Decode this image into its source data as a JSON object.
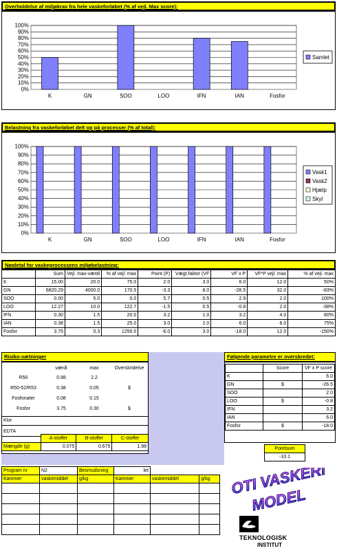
{
  "chart1": {
    "title": "Overholdelse af miljøkrav fra hele vaskeforløbet (% af vejl. Max score):",
    "chart_data": {
      "type": "bar",
      "categories": [
        "K",
        "GN",
        "SOO",
        "LOO",
        "IFN",
        "IAN",
        "Fosfor"
      ],
      "series": [
        {
          "name": "Samlet",
          "values": [
            50,
            0,
            100,
            0,
            80,
            75,
            0
          ]
        }
      ],
      "ylim": [
        0,
        100
      ],
      "yticks": [
        "0%",
        "10%",
        "20%",
        "30%",
        "40%",
        "50%",
        "60%",
        "70%",
        "80%",
        "90%",
        "100%"
      ],
      "legend_position": "right",
      "grid": true
    }
  },
  "chart2": {
    "title": "Belastning fra vaskeforløbet delt op på processer (% af total):",
    "chart_data": {
      "type": "bar",
      "categories": [
        "K",
        "GN",
        "SOO",
        "LOO",
        "IFN",
        "IAN",
        "Fosfor"
      ],
      "series": [
        {
          "name": "Vask1",
          "values": [
            100,
            100,
            100,
            100,
            100,
            100,
            100
          ]
        },
        {
          "name": "Vask2",
          "values": [
            0,
            0,
            0,
            0,
            0,
            0,
            0
          ]
        },
        {
          "name": "Hjælp",
          "values": [
            0,
            0,
            0,
            0,
            0,
            0,
            0
          ]
        },
        {
          "name": "Skyl",
          "values": [
            0,
            0,
            0,
            0,
            0,
            0,
            0
          ]
        }
      ],
      "ylim": [
        0,
        100
      ],
      "yticks": [
        "0%",
        "10%",
        "20%",
        "30%",
        "40%",
        "50%",
        "60%",
        "70%",
        "80%",
        "90%",
        "100%"
      ],
      "legend_position": "right",
      "grid": true
    }
  },
  "colors": {
    "bar": "#8080ff",
    "vask2": "#993366",
    "hjaelp": "#ffffcc",
    "skyl": "#ccffff",
    "yellow": "#ffff00",
    "lavender": "#c8c8f0"
  },
  "table1": {
    "title": "Nøgletal for vaskeprocessens miljøbelastning:",
    "headers": [
      "",
      "Sum",
      "Vejl. max-værdi",
      "% af vejl. max",
      "Point (P)",
      "Vægt.faktor (VF",
      "VF x P",
      "VF*P vejl. max",
      "% af vejl. max"
    ],
    "rows": [
      [
        "K",
        "15.00",
        "20.0",
        "75.0",
        "2.0",
        "3.0",
        "6.0",
        "12.0",
        "50%"
      ],
      [
        "GN",
        "6820.29",
        "4000.0",
        "170.5",
        "-3.3",
        "8.0",
        "-26.5",
        "32.0",
        "-83%"
      ],
      [
        "SOO",
        "0.00",
        "5.0",
        "0.0",
        "5.7",
        "0.5",
        "2.9",
        "2.0",
        "100%"
      ],
      [
        "LOO",
        "12.27",
        "10.0",
        "122.7",
        "-1.5",
        "0.5",
        "-0.8",
        "2.0",
        "-38%"
      ],
      [
        "IFN",
        "0.30",
        "1.5",
        "20.0",
        "3.2",
        "1.0",
        "3.2",
        "4.0",
        "80%"
      ],
      [
        "IAN",
        "0.38",
        "1.5",
        "25.0",
        "3.0",
        "2.0",
        "6.0",
        "8.0",
        "75%"
      ],
      [
        "Fosfor",
        "3.75",
        "0.3",
        "1250.0",
        "-6.0",
        "3.0",
        "-18.0",
        "12.0",
        "-150%"
      ]
    ]
  },
  "risk": {
    "title": "Risiko-sætninger",
    "headers": [
      "",
      "værdi",
      "max",
      "Overskridelse"
    ],
    "rows": [
      [
        "R50",
        "0.98",
        "2.2",
        ""
      ],
      [
        "R50-52/R53",
        "0.38",
        "0.05",
        "$"
      ],
      [
        "Fosfonater",
        "0.08",
        "0.15",
        ""
      ],
      [
        "Fosfor",
        "3.75",
        "0.30",
        "$"
      ]
    ],
    "klor": "Klor",
    "edta": "EDTA",
    "stoffer_headers": [
      "A-stoffer",
      "B-stoffer",
      "C-stoffer"
    ],
    "maengde_label": "Mængde (g)",
    "maengde_values": [
      "0.075",
      "0.675",
      "1.98"
    ]
  },
  "exceed": {
    "title": "Følgende parametre er overskredet:",
    "headers": [
      "",
      "Score",
      "VF x P score"
    ],
    "rows": [
      [
        "K",
        "",
        "6.0"
      ],
      [
        "GN",
        "$",
        "-26.5"
      ],
      [
        "SOO",
        "",
        "2.0"
      ],
      [
        "LOO",
        "$",
        "-0.8"
      ],
      [
        "IFN",
        "",
        "3.2"
      ],
      [
        "IAN",
        "",
        "6.0"
      ],
      [
        "Fosfor",
        "$",
        "-18.0"
      ]
    ],
    "pointsum_label": "Pointsum",
    "pointsum_value": "-10.1"
  },
  "program": {
    "program_label": "Program nr",
    "program_value": "N2",
    "besmudsning_label": "Besmudsning",
    "besmudsning_value": "let",
    "col_headers": [
      "Kammer",
      "vaskemiddel",
      "g/kg",
      "Kammer",
      "vaskemiddel",
      "g/kg"
    ]
  },
  "logo": {
    "wordart_line1": "OTI VASKERI",
    "wordart_line2": "MODEL",
    "brand_line1": "TEKNOLOGISK",
    "brand_line2": "INSTITUT"
  }
}
